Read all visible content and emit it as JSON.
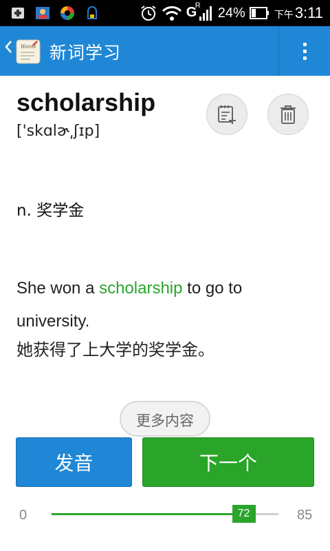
{
  "status_bar": {
    "battery": "24%",
    "time_prefix": "下午",
    "time": "3:11",
    "signal_type": "G",
    "roaming": "R"
  },
  "action_bar": {
    "back_icon": "chevron-left-icon",
    "logo_icon": "app-logo-icon",
    "logo_text": "Words",
    "title": "新词学习",
    "menu_icon": "overflow-menu-icon",
    "color": "#1f87d6"
  },
  "word": {
    "text": "scholarship",
    "phonetic": "['skɑlɚ͵ʃɪp]",
    "definition": "n. 奖学金"
  },
  "example": {
    "before": "She won a ",
    "highlight": "scholarship",
    "after": " to go to university.",
    "translation": "她获得了上大学的奖学金。",
    "highlight_color": "#2aa52a"
  },
  "buttons": {
    "add_icon": "add-to-notebook-icon",
    "delete_icon": "trash-icon",
    "more": "更多内容",
    "pronounce": "发音",
    "next": "下一个"
  },
  "progress": {
    "min": "0",
    "max": "85",
    "current": "72",
    "value": 72,
    "max_value": 85
  }
}
